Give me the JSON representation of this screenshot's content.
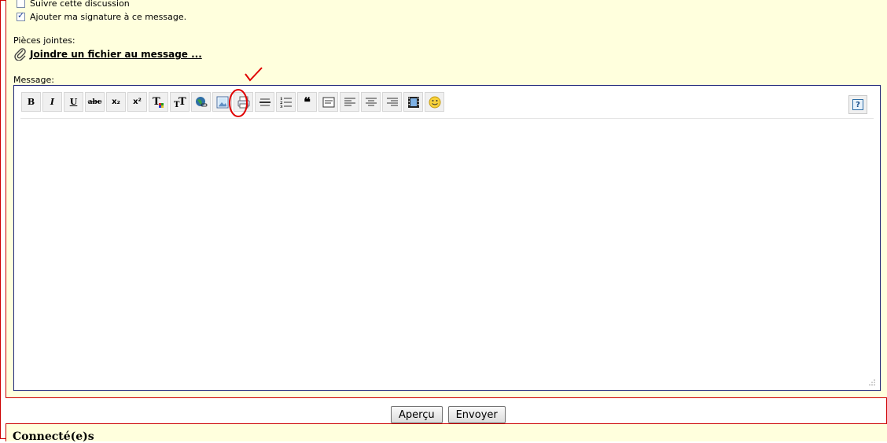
{
  "options": {
    "follow_label": "Suivre cette discussion",
    "follow_checked": false,
    "signature_label": "Ajouter ma signature à ce message.",
    "signature_checked": true
  },
  "attachments": {
    "label": "Pièces jointes:",
    "link": "Joindre un fichier au message ..."
  },
  "message": {
    "label": "Message:",
    "toolbar": [
      {
        "name": "bold-button",
        "glyph": "B"
      },
      {
        "name": "italic-button",
        "glyph": "I"
      },
      {
        "name": "underline-button",
        "glyph": "U"
      },
      {
        "name": "strikethrough-button",
        "glyph": "abc"
      },
      {
        "name": "subscript-button",
        "glyph": "x₂"
      },
      {
        "name": "superscript-button",
        "glyph": "x²"
      },
      {
        "name": "text-color-button",
        "glyph": "T"
      },
      {
        "name": "font-size-button",
        "glyph": "T"
      },
      {
        "name": "insert-link-button",
        "glyph": "🌐"
      },
      {
        "name": "insert-image-button",
        "glyph": "🖼"
      },
      {
        "name": "code-button",
        "glyph": "⎙"
      },
      {
        "name": "horizontal-rule-button",
        "glyph": "≡"
      },
      {
        "name": "numbered-list-button",
        "glyph": "☰"
      },
      {
        "name": "quote-button",
        "glyph": "❝"
      },
      {
        "name": "spoiler-button",
        "glyph": "▤"
      },
      {
        "name": "align-left-button",
        "glyph": "≡"
      },
      {
        "name": "align-center-button",
        "glyph": "≡"
      },
      {
        "name": "align-right-button",
        "glyph": "≡"
      },
      {
        "name": "video-button",
        "glyph": "▦"
      },
      {
        "name": "smiley-button",
        "glyph": "☺"
      }
    ],
    "help_glyph": "?",
    "content": ""
  },
  "actions": {
    "preview_label": "Aperçu",
    "send_label": "Envoyer"
  },
  "footer": {
    "connected_label": "Connecté(e)s"
  },
  "colors": {
    "panel_bg": "#ffffdd",
    "border": "#cc0000",
    "annotation": "#e00000"
  }
}
